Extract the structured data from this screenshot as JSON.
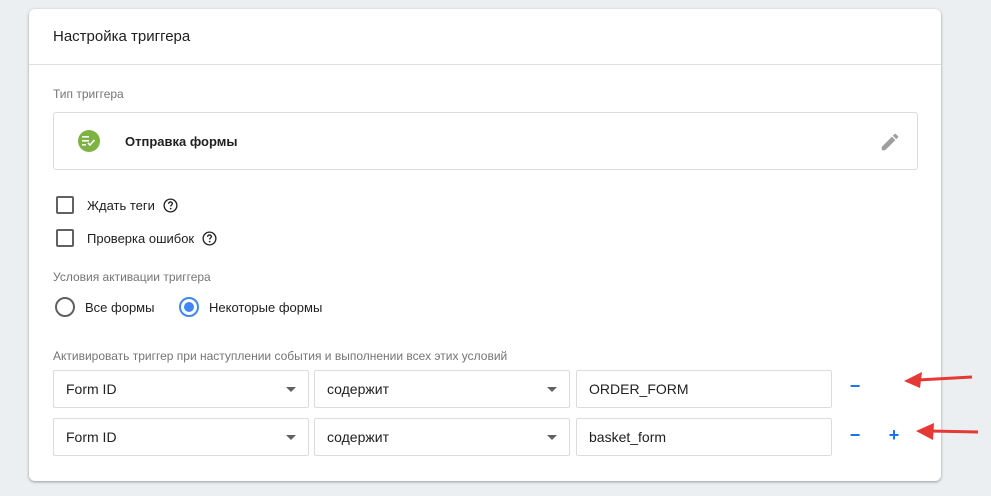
{
  "card": {
    "title": "Настройка триггера"
  },
  "trigger_type": {
    "label": "Тип триггера",
    "name": "Отправка формы"
  },
  "options": {
    "wait_tags": "Ждать теги",
    "check_errors": "Проверка ошибок"
  },
  "activation": {
    "label": "Условия активации триггера",
    "choices": [
      {
        "label": "Все формы",
        "selected": false
      },
      {
        "label": "Некоторые формы",
        "selected": true
      }
    ]
  },
  "conditions": {
    "label": "Активировать триггер при наступлении события и выполнении всех этих условий",
    "rows": [
      {
        "variable": "Form ID",
        "operator": "содержит",
        "value": "ORDER_FORM",
        "minus": "−",
        "plus": ""
      },
      {
        "variable": "Form ID",
        "operator": "содержит",
        "value": "basket_form",
        "minus": "−",
        "plus": "+"
      }
    ]
  },
  "colors": {
    "accent": "#4285f4",
    "form_icon": "#7cb342",
    "annotation_arrow": "#e53935"
  }
}
